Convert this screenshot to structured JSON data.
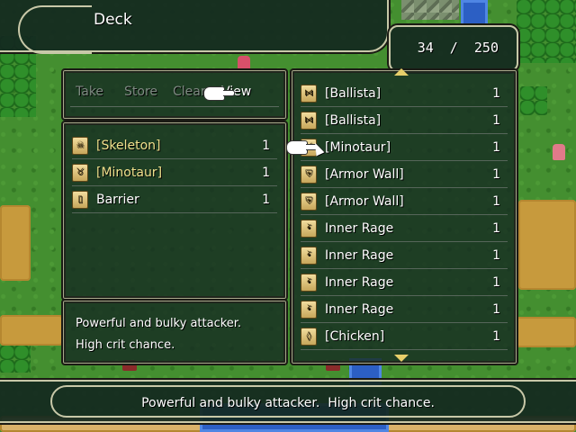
{
  "window": {
    "title": "Deck"
  },
  "counter": {
    "text": "34  /  250"
  },
  "commands": [
    {
      "label": "Take",
      "active": false
    },
    {
      "label": "Store",
      "active": false
    },
    {
      "label": "Clear",
      "active": false
    },
    {
      "label": "View",
      "active": true
    }
  ],
  "deck_list": [
    {
      "name": "[Skeleton]",
      "qty": "1",
      "color": "gold",
      "icon": "skull-icon",
      "glyph": "☠"
    },
    {
      "name": "[Minotaur]",
      "qty": "1",
      "color": "gold",
      "icon": "bull-icon",
      "glyph": "♉"
    },
    {
      "name": "Barrier",
      "qty": "1",
      "color": "white",
      "icon": "barrier-icon",
      "glyph": "▯"
    }
  ],
  "card_list": [
    {
      "name": "[Ballista]",
      "qty": "1",
      "icon": "ballista-icon",
      "glyph": "⋈"
    },
    {
      "name": "[Ballista]",
      "qty": "1",
      "icon": "ballista-icon",
      "glyph": "⋈"
    },
    {
      "name": "[Minotaur]",
      "qty": "1",
      "icon": "bull-icon",
      "glyph": "♉"
    },
    {
      "name": "[Armor Wall]",
      "qty": "1",
      "icon": "armor-icon",
      "glyph": "⛨"
    },
    {
      "name": "[Armor Wall]",
      "qty": "1",
      "icon": "armor-icon",
      "glyph": "⛨"
    },
    {
      "name": "Inner Rage",
      "qty": "1",
      "icon": "rage-face-icon",
      "glyph": "•᷅"
    },
    {
      "name": "Inner Rage",
      "qty": "1",
      "icon": "rage-face-icon",
      "glyph": "•᷅"
    },
    {
      "name": "Inner Rage",
      "qty": "1",
      "icon": "rage-face-icon",
      "glyph": "•᷅"
    },
    {
      "name": "Inner Rage",
      "qty": "1",
      "icon": "rage-face-icon",
      "glyph": "•᷅"
    },
    {
      "name": "[Chicken]",
      "qty": "1",
      "icon": "chicken-icon",
      "glyph": "◊"
    }
  ],
  "description": {
    "line1": "Powerful and bulky attacker.",
    "line2": "High crit chance."
  },
  "help": {
    "text": "Powerful and bulky attacker.  High crit chance."
  },
  "colors": {
    "gold_text": "#f0e08c",
    "panel_bg": "#162c22",
    "frame": "#c8c8a8",
    "disabled_text": "#7e8a82"
  }
}
